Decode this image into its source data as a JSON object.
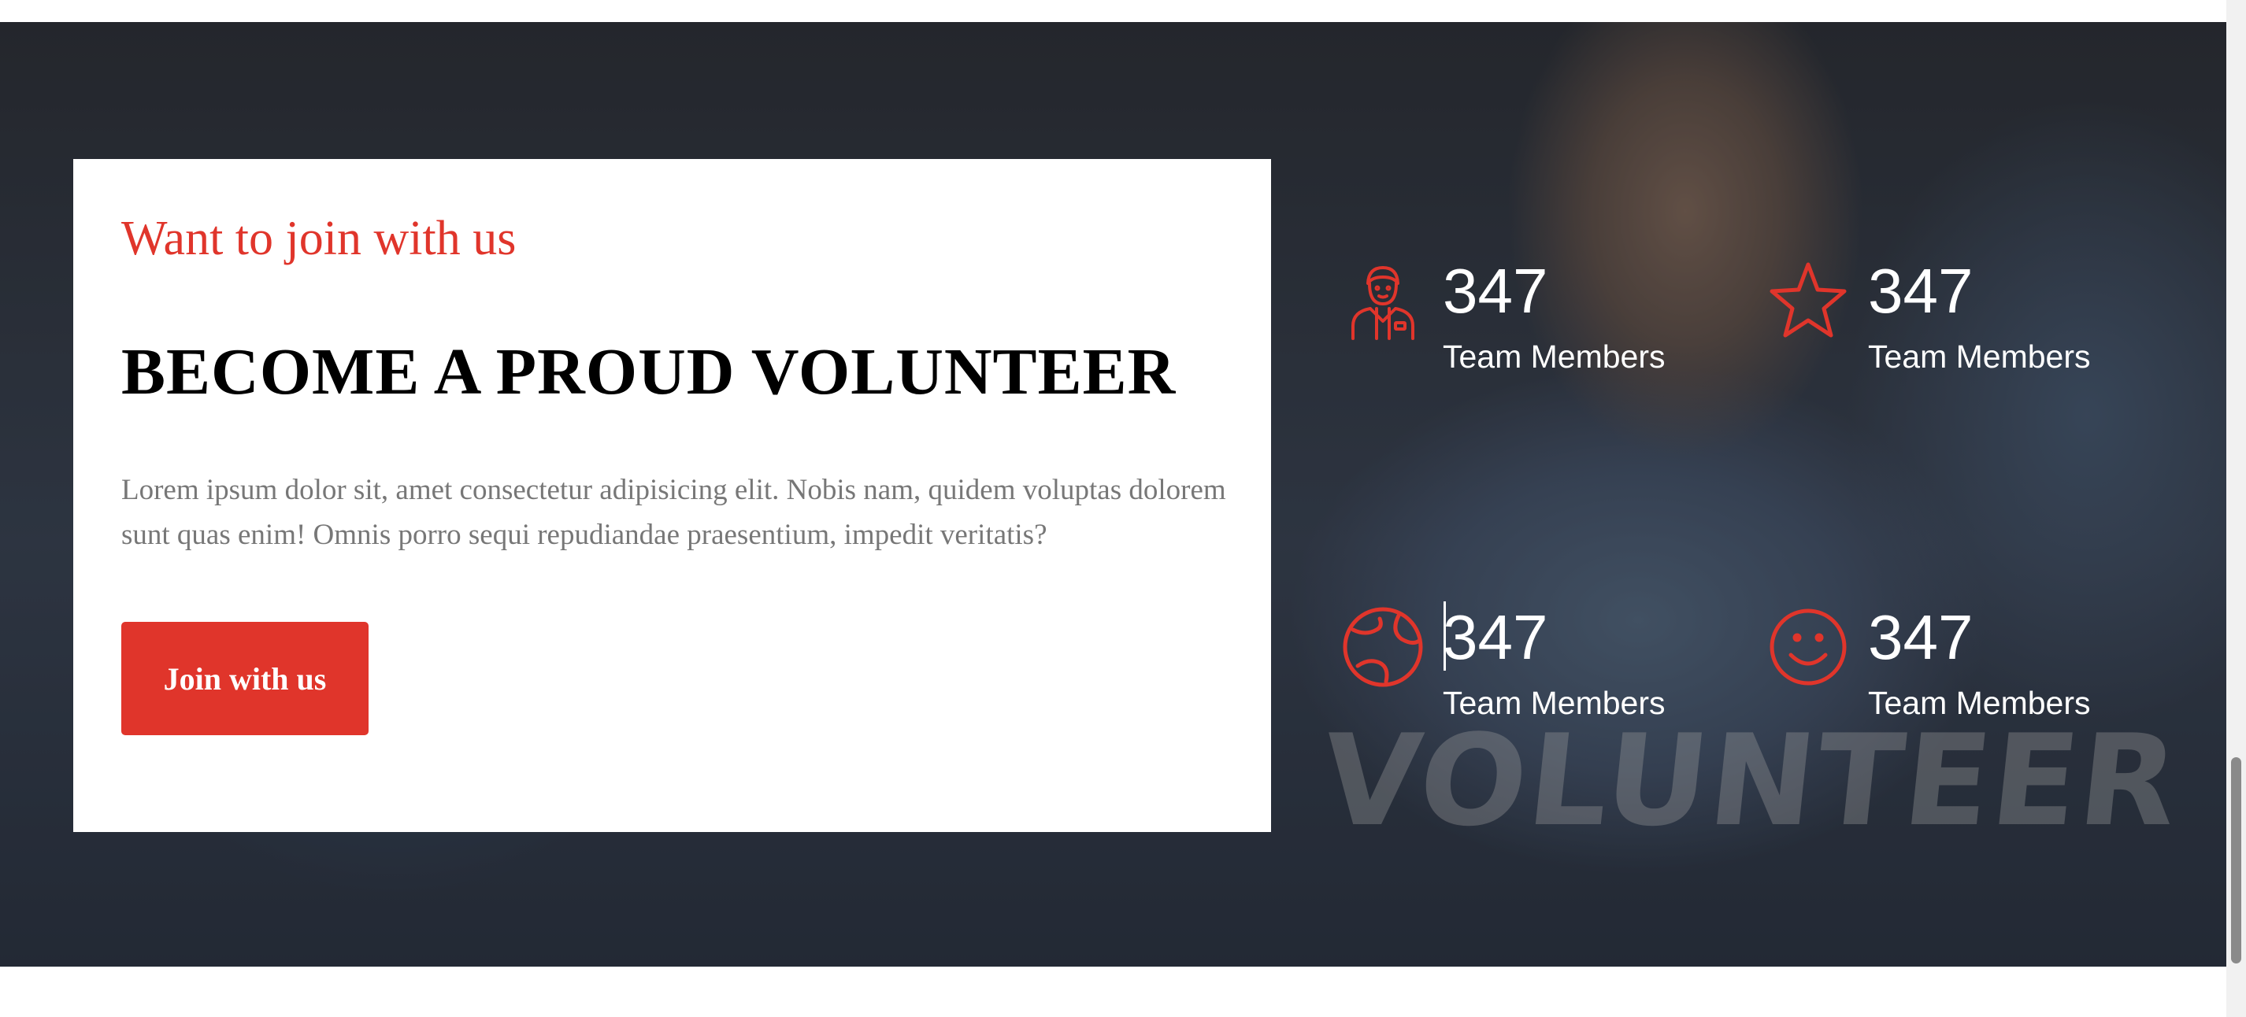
{
  "volunteer": {
    "eyebrow": "Want to join with us",
    "headline": "BECOME A PROUD VOLUNTEER",
    "body": "Lorem ipsum dolor sit, amet consectetur adipisicing elit. Nobis nam, quidem voluptas dolorem sunt quas enim! Omnis porro sequi repudiandae praesentium, impedit veritatis?",
    "button_label": "Join with us"
  },
  "stats": [
    {
      "icon": "volunteer-person-icon",
      "value": "347",
      "label": "Team Members"
    },
    {
      "icon": "star-icon",
      "value": "347",
      "label": "Team Members"
    },
    {
      "icon": "globe-icon",
      "value": "347",
      "label": "Team Members"
    },
    {
      "icon": "smiley-face-icon",
      "value": "347",
      "label": "Team Members"
    }
  ],
  "colors": {
    "accent": "#e0352b",
    "heading": "#000000",
    "body_text": "#777777",
    "stat_text": "#ffffff"
  }
}
